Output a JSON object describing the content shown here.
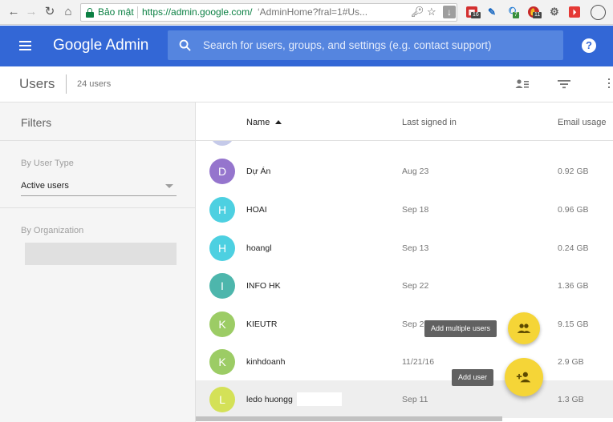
{
  "browser": {
    "back_icon": "arrow-left-icon",
    "forward_icon": "arrow-right-icon",
    "reload_icon": "reload-icon",
    "home_icon": "home-icon",
    "secure_label": "Bảo mật",
    "url_host": "https://admin.google.com/",
    "url_path": "‘AdminHome?fral=1#Us...",
    "ext_badges": [
      "16",
      "7",
      "11"
    ]
  },
  "appbar": {
    "title": "Google Admin",
    "search_placeholder": "Search for users, groups, and settings (e.g. contact support)",
    "help_label": "?",
    "color": "#3367d6"
  },
  "subbar": {
    "title": "Users",
    "count": "24 users"
  },
  "filters": {
    "title": "Filters",
    "user_type_label": "By User Type",
    "user_type_value": "Active users",
    "org_label": "By Organization"
  },
  "table": {
    "columns": {
      "name": "Name",
      "last_signed_in": "Last signed in",
      "email_usage": "Email usage"
    },
    "rows": [
      {
        "initial": "D",
        "name": "Dự Án",
        "last": "Aug 23",
        "usage": "0.92 GB",
        "color": "#9575cd"
      },
      {
        "initial": "H",
        "name": "HOAI",
        "last": "Sep 18",
        "usage": "0.96 GB",
        "color": "#4dd0e1"
      },
      {
        "initial": "H",
        "name": "hoangl",
        "last": "Sep 13",
        "usage": "0.24 GB",
        "color": "#4dd0e1"
      },
      {
        "initial": "I",
        "name": "INFO HK",
        "last": "Sep 22",
        "usage": "1.36 GB",
        "color": "#4db6ac"
      },
      {
        "initial": "K",
        "name": "KIEUTR",
        "last": "Sep 2",
        "usage": "9.15 GB",
        "color": "#9ccc65"
      },
      {
        "initial": "K",
        "name": "kinhdoanh",
        "last": "11/21/16",
        "usage": "2.9 GB",
        "color": "#9ccc65"
      },
      {
        "initial": "L",
        "name": "ledo huongg",
        "last": "Sep 11",
        "usage": "1.3 GB",
        "color": "#d4e157"
      }
    ]
  },
  "fab": {
    "add_multiple_label": "Add multiple users",
    "add_user_label": "Add user",
    "color": "#f5d537"
  }
}
